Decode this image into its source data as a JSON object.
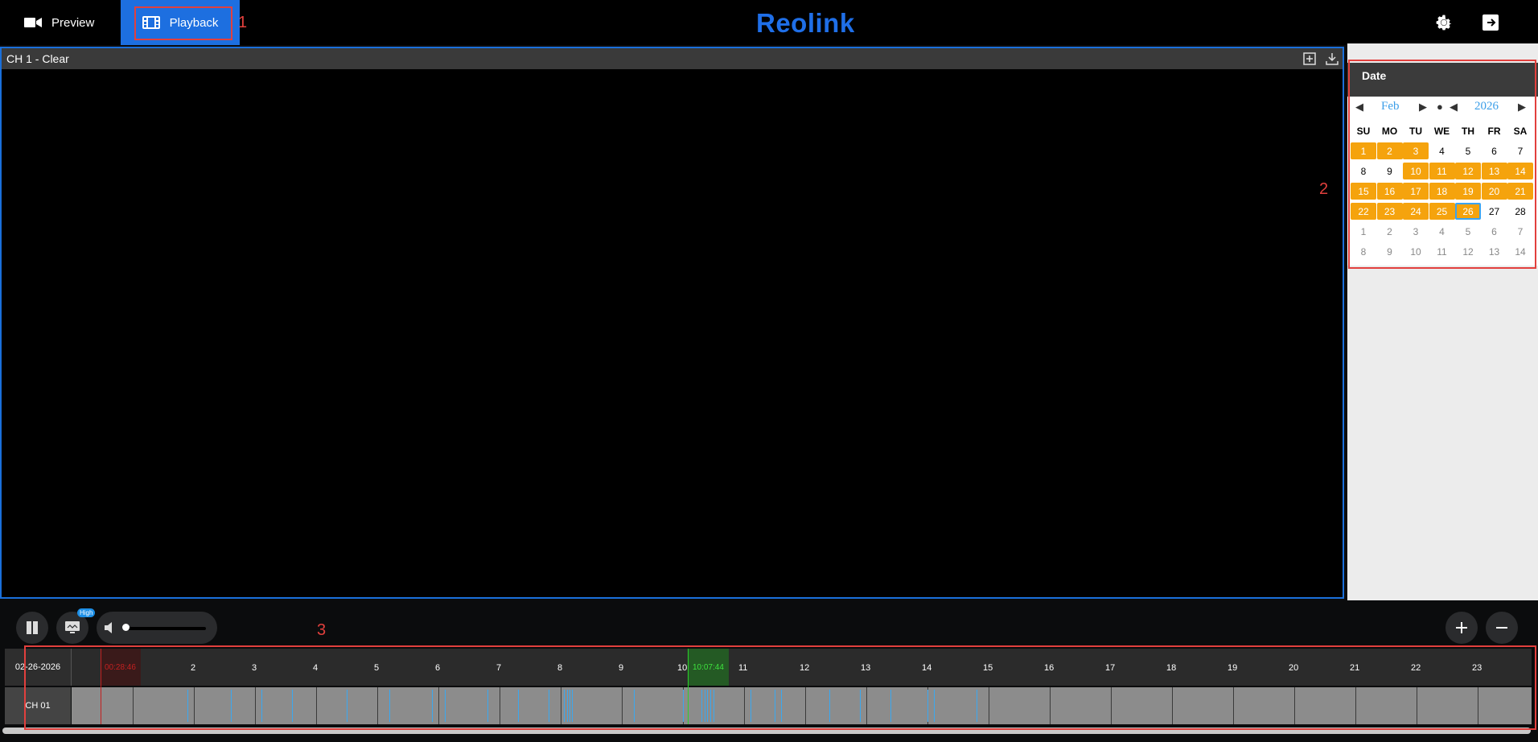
{
  "nav": {
    "tabs": [
      {
        "label": "Preview",
        "icon": "video-camera-icon"
      },
      {
        "label": "Playback",
        "icon": "film-icon",
        "active": true
      }
    ],
    "brand": "Reolink",
    "icons": [
      "gear-icon",
      "logout-icon"
    ]
  },
  "annotations": [
    "1",
    "2",
    "3"
  ],
  "player": {
    "title": "CH 1 - Clear",
    "icons": [
      "fullscreen-icon",
      "download-icon"
    ]
  },
  "date_panel": {
    "title": "Date",
    "month": "Feb",
    "year": "2026",
    "weekdays": [
      "SU",
      "MO",
      "TU",
      "WE",
      "TH",
      "FR",
      "SA"
    ],
    "weeks": [
      [
        "1",
        "2",
        "3",
        "4",
        "5",
        "6",
        "7"
      ],
      [
        "8",
        "9",
        "10",
        "11",
        "12",
        "13",
        "14"
      ],
      [
        "15",
        "16",
        "17",
        "18",
        "19",
        "20",
        "21"
      ],
      [
        "22",
        "23",
        "24",
        "25",
        "26",
        "27",
        "28"
      ],
      [
        "1",
        "2",
        "3",
        "4",
        "5",
        "6",
        "7"
      ],
      [
        "8",
        "9",
        "10",
        "11",
        "12",
        "13",
        "14"
      ]
    ],
    "recorded_days": [
      1,
      2,
      3,
      10,
      11,
      12,
      13,
      14,
      15,
      16,
      17,
      18,
      19,
      20,
      21,
      22,
      23,
      24,
      25,
      26
    ],
    "selected_day": 26,
    "record_color": "#f5a30d",
    "select_color": "#3aa3f0"
  },
  "controls": {
    "stream_badge": "High",
    "icons": [
      "pause-icon",
      "stream-quality-icon",
      "volume-icon",
      "zoom-in-icon",
      "zoom-out-icon"
    ]
  },
  "timeline": {
    "date": "02-26-2026",
    "channel": "CH 01",
    "hour_labels": [
      "2",
      "3",
      "4",
      "5",
      "6",
      "7",
      "8",
      "9",
      "10",
      "11",
      "12",
      "13",
      "14",
      "15",
      "16",
      "17",
      "18",
      "19",
      "20",
      "21",
      "22",
      "23"
    ],
    "start_time": "00:28:46",
    "current_time": "10:07:44",
    "event_color": "#3aa8f0"
  }
}
